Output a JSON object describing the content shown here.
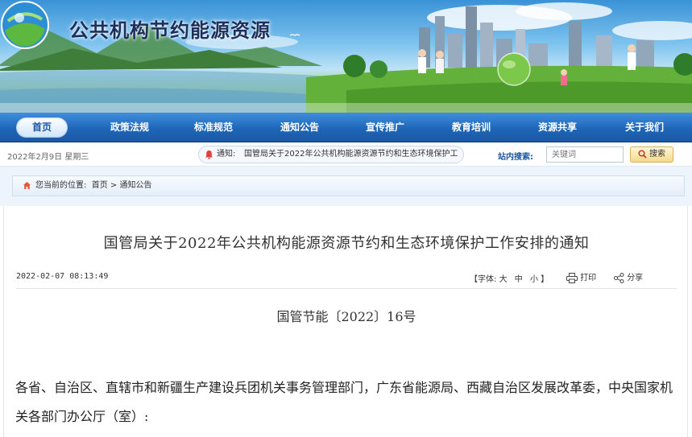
{
  "site": {
    "title": "公共机构节约能源资源"
  },
  "nav": {
    "items": [
      {
        "label": "首页"
      },
      {
        "label": "政策法规"
      },
      {
        "label": "标准规范"
      },
      {
        "label": "通知公告"
      },
      {
        "label": "宣传推广"
      },
      {
        "label": "教育培训"
      },
      {
        "label": "资源共享"
      },
      {
        "label": "关于我们"
      }
    ]
  },
  "infobar": {
    "date": "2022年2月9日  星期三",
    "notice_label": "通知:",
    "notice_text": "国管局关于2022年公共机构能源资源节约和生态环境保护工",
    "search_label": "站内搜索:",
    "search_placeholder": "关键词",
    "search_button": "搜索"
  },
  "breadcrumb": {
    "prefix": "您当前的位置:",
    "home": "首页",
    "sep": ">",
    "current": "通知公告"
  },
  "article": {
    "title": "国管局关于2022年公共机构能源资源节约和生态环境保护工作安排的通知",
    "pubtime": "2022-02-07 08:13:49",
    "font_label": "【字体:",
    "font_large": "大",
    "font_medium": "中",
    "font_small": "小",
    "font_end": "】",
    "print_label": "打印",
    "share_label": "分享",
    "doc_number": "国管节能〔2022〕16号",
    "paragraph_1": "各省、自治区、直辖市和新疆生产建设兵团机关事务管理部门，广东省能源局、西藏自治区发展改革委，中央国家机关各部门办公厅（室）:"
  },
  "icons": {
    "logo": "globe-logo-icon",
    "bell": "bell-icon",
    "magnifier": "magnifier-icon",
    "home": "home-icon",
    "printer": "printer-icon",
    "share": "share-icon"
  },
  "colors": {
    "nav_blue": "#1f66b8",
    "title_navy": "#1d2f5c",
    "search_button": "#f4d98a"
  }
}
